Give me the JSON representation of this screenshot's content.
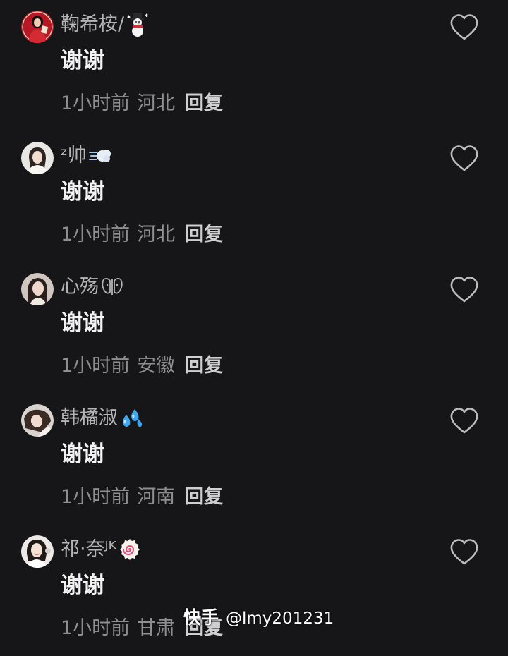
{
  "colors": {
    "background": "#161619",
    "username": "#b4b4b7",
    "comment_text": "#f2f2f3",
    "meta_text": "#8e8e92",
    "reply": "#cfcfd2",
    "like_icon_stroke": "#bdbdc0"
  },
  "comments": [
    {
      "username": "鞠希桉/",
      "name_emoji": "snowman-emoji",
      "text": "谢谢",
      "time": "1小时前",
      "region": "河北",
      "reply_label": "回复",
      "avatar": "red-outfit-avatar",
      "like_icon": "heart-outline-icon"
    },
    {
      "username": "ᶻ帅",
      "name_emoji": "dash-puff-emoji",
      "text": "谢谢",
      "time": "1小时前",
      "region": "河北",
      "reply_label": "回复",
      "avatar": "white-portrait-avatar",
      "like_icon": "heart-outline-icon"
    },
    {
      "username": "心殇",
      "name_emoji": "moth-glyph",
      "text": "谢谢",
      "time": "1小时前",
      "region": "安徽",
      "reply_label": "回复",
      "avatar": "dark-hair-portrait-avatar",
      "like_icon": "heart-outline-icon"
    },
    {
      "username": "韩橘淑",
      "name_emoji": "sweat-drops-emoji",
      "text": "谢谢",
      "time": "1小时前",
      "region": "河南",
      "reply_label": "回复",
      "avatar": "lying-portrait-avatar",
      "like_icon": "heart-outline-icon"
    },
    {
      "username": "祁·奈ᴶᴷ",
      "name_emoji": "fish-cake-swirl-emoji",
      "text": "谢谢",
      "time": "1小时前",
      "region": "甘肃",
      "reply_label": "回复",
      "avatar": "smiling-portrait-avatar",
      "like_icon": "heart-outline-icon"
    }
  ],
  "watermark": {
    "brand": "快手",
    "handle": "@lmy201231"
  }
}
